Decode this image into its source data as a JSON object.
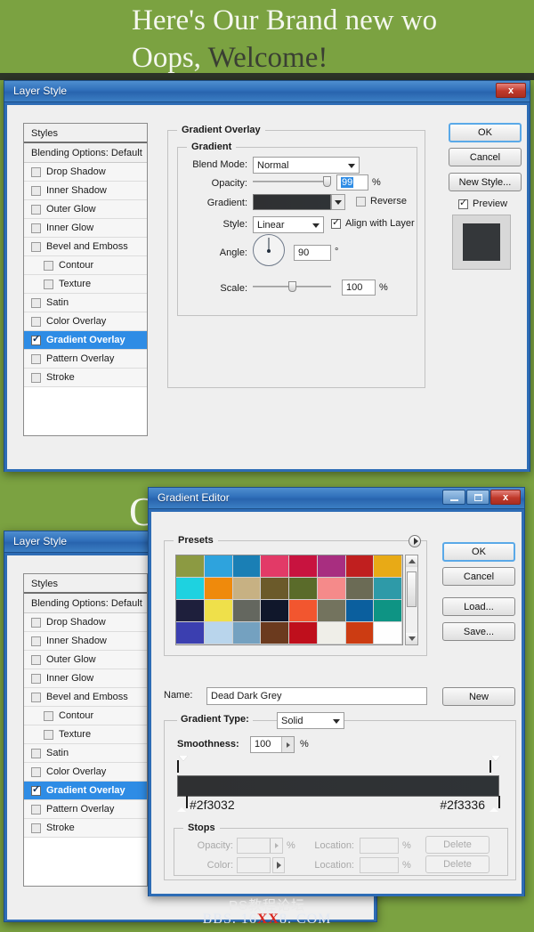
{
  "background": {
    "color": "#7ba241",
    "banner_line1": "Here's Our Brand new wo",
    "banner_line2_a": "Oops, ",
    "banner_line2_b": "Welcome!",
    "stray_letter": "O"
  },
  "watermark": {
    "line1": "PS教程论坛",
    "line2_pre": "BBS. 16",
    "line2_red": "XX",
    "line2_post": "8. COM"
  },
  "layer_style": {
    "title": "Layer Style",
    "close_label": "x",
    "styles_panel": {
      "header": "Styles",
      "blending_options": "Blending Options: Default",
      "items": [
        {
          "label": "Drop Shadow",
          "checked": false,
          "indent": false,
          "selected": false
        },
        {
          "label": "Inner Shadow",
          "checked": false,
          "indent": false,
          "selected": false
        },
        {
          "label": "Outer Glow",
          "checked": false,
          "indent": false,
          "selected": false
        },
        {
          "label": "Inner Glow",
          "checked": false,
          "indent": false,
          "selected": false
        },
        {
          "label": "Bevel and Emboss",
          "checked": false,
          "indent": false,
          "selected": false
        },
        {
          "label": "Contour",
          "checked": false,
          "indent": true,
          "selected": false
        },
        {
          "label": "Texture",
          "checked": false,
          "indent": true,
          "selected": false
        },
        {
          "label": "Satin",
          "checked": false,
          "indent": false,
          "selected": false
        },
        {
          "label": "Color Overlay",
          "checked": false,
          "indent": false,
          "selected": false
        },
        {
          "label": "Gradient Overlay",
          "checked": true,
          "indent": false,
          "selected": true
        },
        {
          "label": "Pattern Overlay",
          "checked": false,
          "indent": false,
          "selected": false
        },
        {
          "label": "Stroke",
          "checked": false,
          "indent": false,
          "selected": false
        }
      ]
    },
    "panel": {
      "section_title": "Gradient Overlay",
      "group_title": "Gradient",
      "blend_mode_label": "Blend Mode:",
      "blend_mode_value": "Normal",
      "opacity_label": "Opacity:",
      "opacity_value": "99",
      "opacity_unit": "%",
      "gradient_label": "Gradient:",
      "gradient_from": "#2f3032",
      "gradient_to": "#2f3336",
      "reverse_label": "Reverse",
      "reverse_checked": false,
      "style_label": "Style:",
      "style_value": "Linear",
      "align_label": "Align with Layer",
      "align_checked": true,
      "angle_label": "Angle:",
      "angle_value": "90",
      "angle_unit": "°",
      "scale_label": "Scale:",
      "scale_value": "100",
      "scale_unit": "%"
    },
    "buttons": {
      "ok": "OK",
      "cancel": "Cancel",
      "new_style": "New Style...",
      "preview_label": "Preview",
      "preview_checked": true,
      "preview_swatch_color": "#34373a"
    }
  },
  "gradient_editor": {
    "title": "Gradient Editor",
    "window_buttons": {
      "minimize": "minimize-icon",
      "maximize": "maximize-icon",
      "close": "x"
    },
    "presets": {
      "group_title": "Presets",
      "menu_icon": "presets-menu-icon",
      "swatches": [
        "#8c9a42",
        "#2ea3dd",
        "#1a7fb5",
        "#e23a67",
        "#c8133f",
        "#a82e80",
        "#c01f1f",
        "#e8aa16",
        "#1ed2e0",
        "#ef8a0c",
        "#c7b183",
        "#6b5a2a",
        "#5a6b2a",
        "#f58a8a",
        "#6b6b55",
        "#2e9aa8",
        "#1e1f3c",
        "#efe04a",
        "#64675f",
        "#10172b",
        "#f2562f",
        "#73735e",
        "#0b5f9e",
        "#0e9484",
        "#3b3fb0",
        "#b9d5ec",
        "#74a1c0",
        "#6b3a1e",
        "#bf0f1c",
        "#efeee8",
        "#cc3c12",
        "#fefefe"
      ]
    },
    "name_label": "Name:",
    "name_value": "Dead Dark Grey",
    "new_button": "New",
    "gradient_type_label": "Gradient Type:",
    "gradient_type_value": "Solid",
    "smoothness_label": "Smoothness:",
    "smoothness_value": "100",
    "smoothness_unit": "%",
    "bar_from": "#2f3032",
    "bar_to": "#2f3336",
    "hex_left": "#2f3032",
    "hex_right": "#2f3336",
    "stops": {
      "group_title": "Stops",
      "opacity_label": "Opacity:",
      "opacity_value": "",
      "opacity_unit": "%",
      "opacity_location_label": "Location:",
      "opacity_location_value": "",
      "opacity_location_unit": "%",
      "opacity_delete": "Delete",
      "color_label": "Color:",
      "color_location_label": "Location:",
      "color_location_value": "",
      "color_location_unit": "%",
      "color_delete": "Delete"
    },
    "buttons": {
      "ok": "OK",
      "cancel": "Cancel",
      "load": "Load...",
      "save": "Save..."
    }
  }
}
